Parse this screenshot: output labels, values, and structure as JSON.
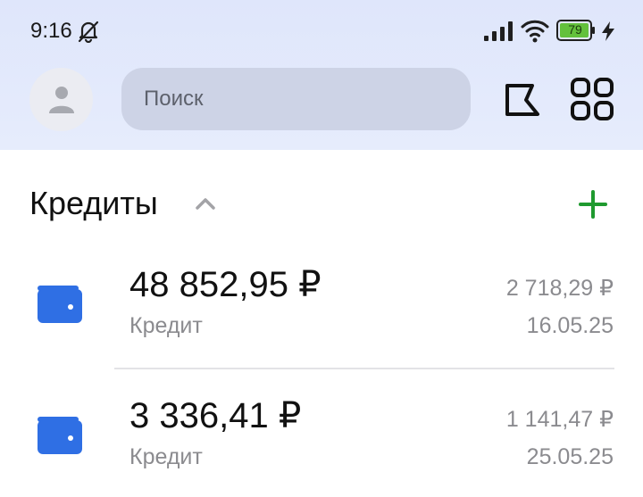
{
  "status_bar": {
    "time": "9:16",
    "battery_level": "79",
    "icons": [
      "bell-off-icon",
      "signal-icon",
      "wifi-icon",
      "battery-icon",
      "charging-icon"
    ]
  },
  "header": {
    "search": {
      "placeholder": "Поиск",
      "value": ""
    },
    "icons": [
      "avatar-icon",
      "flag-icon",
      "grid-icon"
    ]
  },
  "section": {
    "title": "Кредиты",
    "expanded": true
  },
  "loans": [
    {
      "amount": "48 852,95 ₽",
      "label": "Кредит",
      "payment": "2 718,29 ₽",
      "date": "16.05.25"
    },
    {
      "amount": "3 336,41 ₽",
      "label": "Кредит",
      "payment": "1 141,47 ₽",
      "date": "25.05.25"
    }
  ],
  "colors": {
    "header_background": "#dfe6fb",
    "search_background": "#cdd3e6",
    "accent_green": "#1f9a2f",
    "wallet_blue": "#2f6fe4",
    "secondary_text": "#8b8b8f"
  }
}
